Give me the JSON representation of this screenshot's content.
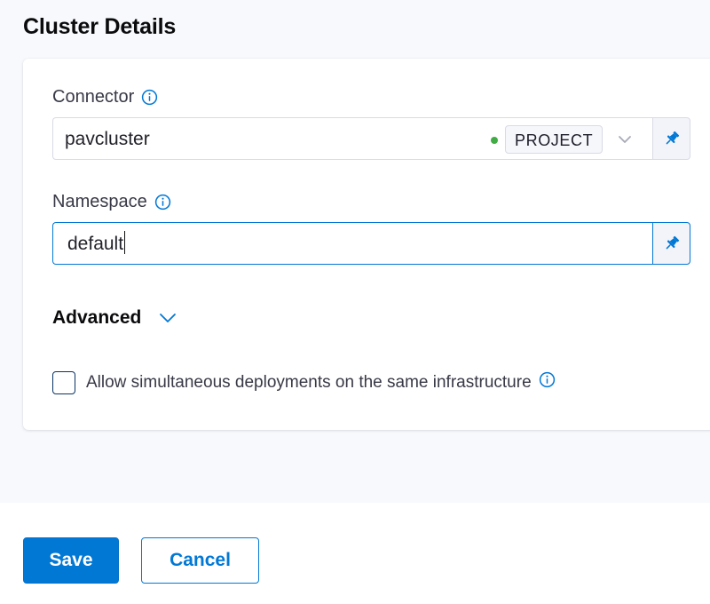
{
  "cluster_details": {
    "title": "Cluster Details",
    "connector": {
      "label": "Connector",
      "value": "pavcluster",
      "scope_badge": "PROJECT",
      "status_color": "#42ab45"
    },
    "namespace": {
      "label": "Namespace",
      "value": "default"
    },
    "advanced": {
      "label": "Advanced",
      "expanded": false
    },
    "simultaneous_deployments": {
      "label": "Allow simultaneous deployments on the same infrastructure",
      "checked": false
    }
  },
  "footer": {
    "save_label": "Save",
    "cancel_label": "Cancel"
  },
  "icons": {
    "info": "info-icon",
    "pin": "pin-icon",
    "chevron": "chevron-down-icon"
  },
  "colors": {
    "accent": "#0278d5",
    "status_dot": "#42ab45",
    "background": "#f7f9fc"
  }
}
